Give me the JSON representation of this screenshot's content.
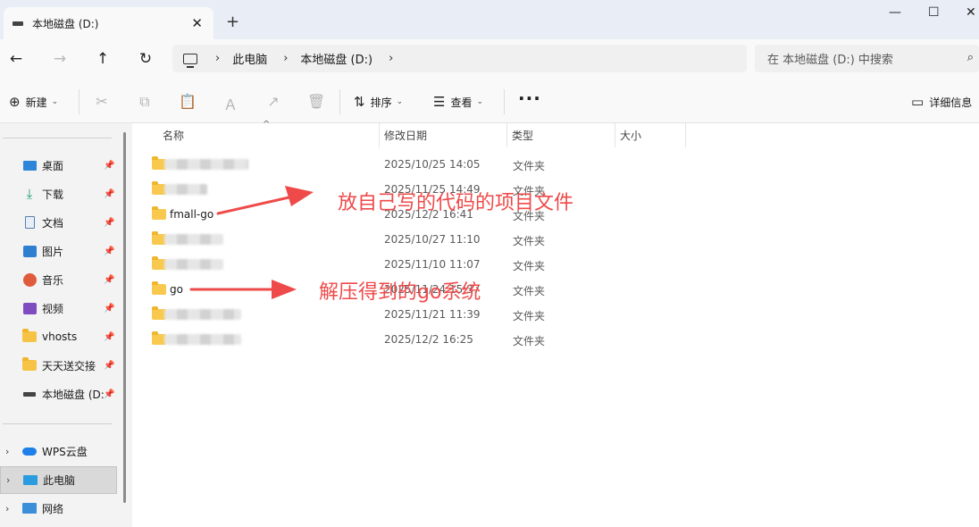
{
  "tab": {
    "title": "本地磁盘 (D:)",
    "close": "✕",
    "new_tab": "+"
  },
  "window": {
    "minimize": "—",
    "maximize": "☐",
    "close": "✕"
  },
  "nav": {
    "back": "←",
    "forward": "→",
    "up": "↑",
    "refresh": "↻"
  },
  "address": {
    "separator": "›",
    "crumbs": [
      "此电脑",
      "本地磁盘 (D:)"
    ]
  },
  "search": {
    "placeholder": "在 本地磁盘 (D:) 中搜索",
    "icon": "⌕"
  },
  "commands": {
    "new_label": "新建",
    "sort_label": "排序",
    "view_label": "查看",
    "more_label": "···",
    "details_label": "详细信息"
  },
  "sidebar": {
    "quick": [
      {
        "label": "桌面",
        "icon": "desktop-icon"
      },
      {
        "label": "下载",
        "icon": "download-icon"
      },
      {
        "label": "文档",
        "icon": "document-icon"
      },
      {
        "label": "图片",
        "icon": "picture-icon"
      },
      {
        "label": "音乐",
        "icon": "music-icon"
      },
      {
        "label": "视频",
        "icon": "video-icon"
      },
      {
        "label": "vhosts",
        "icon": "folder-icon"
      },
      {
        "label": "天天送交接",
        "icon": "folder-icon"
      },
      {
        "label": "本地磁盘 (D:",
        "icon": "drive-icon"
      }
    ],
    "tree": [
      {
        "label": "WPS云盘",
        "icon": "cloud-icon"
      },
      {
        "label": "此电脑",
        "icon": "computer-icon",
        "selected": true
      },
      {
        "label": "网络",
        "icon": "network-icon"
      }
    ]
  },
  "columns": {
    "name": "名称",
    "modified": "修改日期",
    "type": "类型",
    "size": "大小"
  },
  "files": [
    {
      "name": "",
      "date": "2025/10/25 14:05",
      "type": "文件夹"
    },
    {
      "name": "",
      "date": "2025/11/25 14:49",
      "type": "文件夹"
    },
    {
      "name": "fmall-go",
      "date": "2025/12/2 16:41",
      "type": "文件夹"
    },
    {
      "name": "",
      "date": "2025/10/27 11:10",
      "type": "文件夹"
    },
    {
      "name": "",
      "date": "2025/11/10 11:07",
      "type": "文件夹"
    },
    {
      "name": "go",
      "date": "2025/11/24 15:37",
      "type": "文件夹"
    },
    {
      "name": "",
      "date": "2025/11/21 11:39",
      "type": "文件夹"
    },
    {
      "name": "",
      "date": "2025/12/2 16:25",
      "type": "文件夹"
    }
  ],
  "annotations": {
    "fmall": "放自己写的代码的项目文件",
    "go": "解压得到的go系统",
    "color": "#ef4a4a"
  }
}
